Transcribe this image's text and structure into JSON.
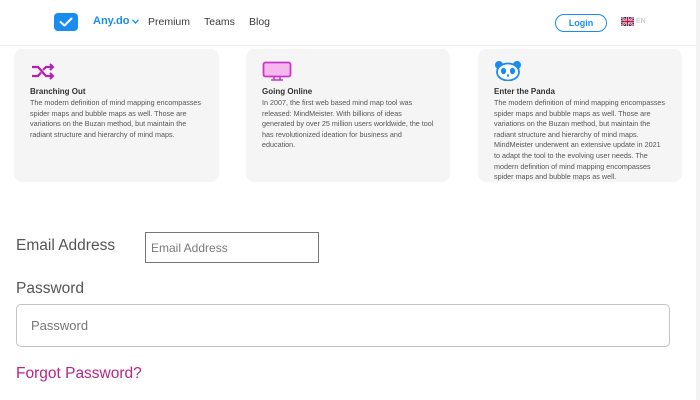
{
  "header": {
    "brand": "Any.do",
    "nav": [
      "Premium",
      "Teams",
      "Blog"
    ],
    "login_label": "Login",
    "lang_code": "EN"
  },
  "cards": [
    {
      "icon": "shuffle-icon",
      "title": "Branching Out",
      "text": "The modern definition of mind mapping encompasses spider maps and bubble maps as well. Those are variations on the Buzan method, but maintain the radiant structure and hierarchy of mind maps."
    },
    {
      "icon": "monitor-icon",
      "title": "Going Online",
      "text": "In 2007, the first web based mind map tool was released: MindMeister. With billions of ideas generated by over 25 million users worldwide, the tool has revolutionized ideation for business and education."
    },
    {
      "icon": "panda-icon",
      "title": "Enter the Panda",
      "text": "The modern definition of mind mapping encompasses spider maps and bubble maps as well. Those are variations on the Buzan method, but maintain the radiant structure and hierarchy of mind maps. MindMeister underwent an extensive update in 2021 to adapt the tool to the evolving user needs. The modern definition of mind mapping encompasses spider maps and bubble maps as well."
    }
  ],
  "form": {
    "email_label": "Email Address",
    "email_placeholder": "Email Address",
    "password_label": "Password",
    "password_placeholder": "Password",
    "forgot_label": "Forgot Password?"
  },
  "colors": {
    "brand": "#1a8cf0",
    "card_icon": "#b31fb3",
    "link": "#b7248a"
  }
}
